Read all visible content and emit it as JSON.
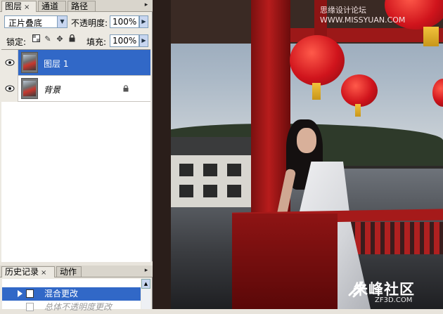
{
  "layers_panel": {
    "tabs": [
      {
        "label": "图层",
        "active": true,
        "close": "×"
      },
      {
        "label": "通道",
        "active": false
      },
      {
        "label": "路径",
        "active": false
      }
    ],
    "panel_menu_icon": "panel-menu-arrow",
    "blend_mode": "正片叠底",
    "opacity_label": "不透明度:",
    "opacity_value": "100%",
    "lock_label": "锁定:",
    "lock_icons": [
      "lock-transparent-icon",
      "lock-paint-icon",
      "lock-move-icon",
      "lock-all-icon"
    ],
    "fill_label": "填充:",
    "fill_value": "100%",
    "layers": [
      {
        "name": "图层 1",
        "selected": true,
        "visible": true
      },
      {
        "name": "背景",
        "selected": false,
        "visible": true,
        "locked": true
      }
    ]
  },
  "history_panel": {
    "tabs": [
      {
        "label": "历史记录",
        "active": true,
        "close": "×"
      },
      {
        "label": "动作",
        "active": false
      }
    ],
    "items": [
      {
        "label": "混合更改",
        "selected": true
      },
      {
        "label": "总体不透明度更改",
        "faded": true
      }
    ]
  },
  "photo": {
    "watermark_top": "思缘设计论坛 WWW.MISSYUAN.COM",
    "watermark_bottom": "朱峰社区",
    "watermark_bottom_sub": "ZF3D.COM"
  },
  "colors": {
    "selection": "#3168c7",
    "panel_bg": "#ece9e2",
    "pillar_red": "#b71c1c"
  }
}
